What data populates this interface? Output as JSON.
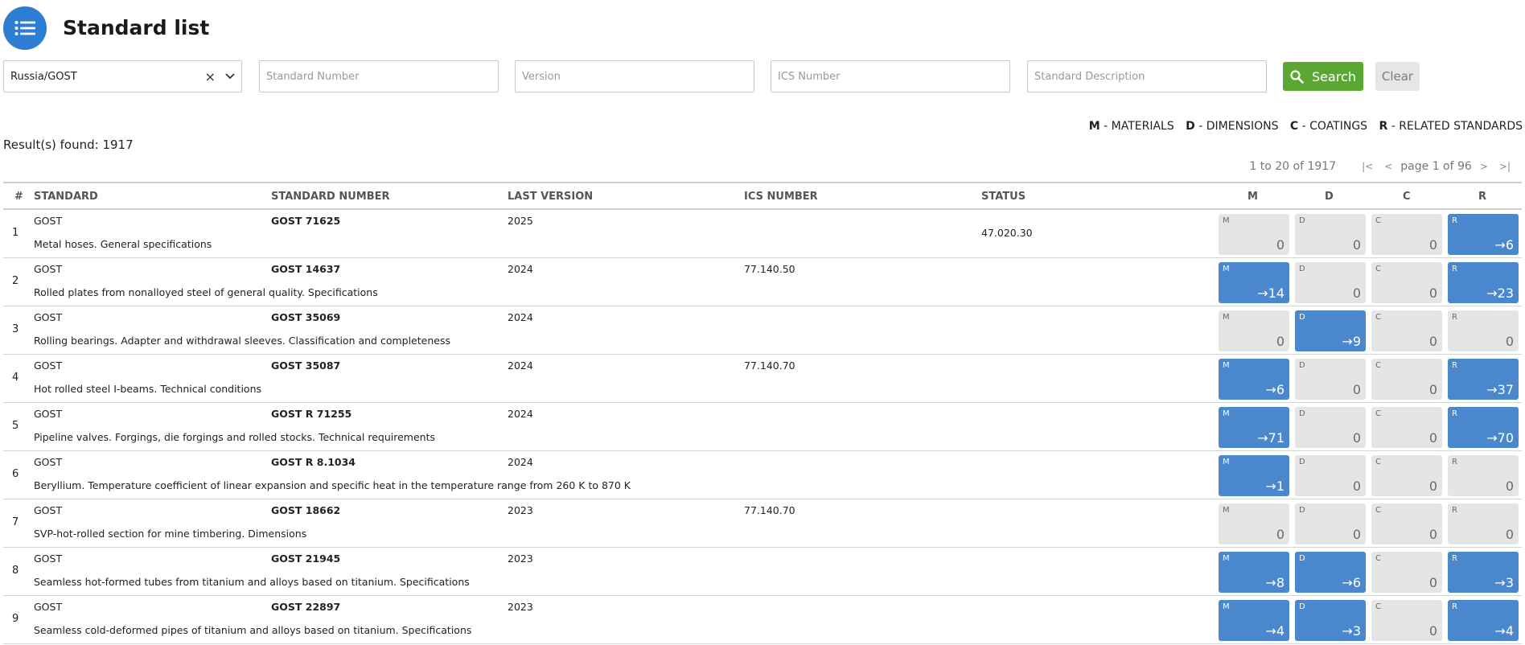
{
  "header": {
    "title": "Standard list",
    "menu_icon": "list-icon"
  },
  "filters": {
    "country_value": "Russia/GOST",
    "standard_number_placeholder": "Standard Number",
    "version_placeholder": "Version",
    "ics_placeholder": "ICS Number",
    "description_placeholder": "Standard Description",
    "search_label": "Search",
    "clear_label": "Clear"
  },
  "legend": {
    "m_key": "M",
    "m_text": "- MATERIALS",
    "d_key": "D",
    "d_text": "- DIMENSIONS",
    "c_key": "C",
    "c_text": "- COATINGS",
    "r_key": "R",
    "r_text": "- RELATED STANDARDS"
  },
  "results_text": "Result(s) found: 1917",
  "pager": {
    "range_text": "1 to 20 of 1917",
    "page_text": "page 1 of 96"
  },
  "columns": {
    "num": "#",
    "standard": "STANDARD",
    "standard_number": "STANDARD NUMBER",
    "last_version": "LAST VERSION",
    "ics_number": "ICS NUMBER",
    "status": "STATUS",
    "m": "M",
    "d": "D",
    "c": "C",
    "r": "R"
  },
  "rows": [
    {
      "num": "1",
      "standard": "GOST",
      "description": "Metal hoses. General specifications",
      "number": "GOST 71625",
      "version": "2025",
      "ics": "",
      "status": "47.020.30",
      "m": "0",
      "d": "0",
      "c": "0",
      "r": "→6"
    },
    {
      "num": "2",
      "standard": "GOST",
      "description": "Rolled plates from nonalloyed steel of general quality. Specifications",
      "number": "GOST 14637",
      "version": "2024",
      "ics": "77.140.50",
      "status": "",
      "m": "→14",
      "d": "0",
      "c": "0",
      "r": "→23"
    },
    {
      "num": "3",
      "standard": "GOST",
      "description": "Rolling bearings. Adapter and withdrawal sleeves. Classification and completeness",
      "number": "GOST 35069",
      "version": "2024",
      "ics": "",
      "status": "",
      "m": "0",
      "d": "→9",
      "c": "0",
      "r": "0"
    },
    {
      "num": "4",
      "standard": "GOST",
      "description": "Hot rolled steel I-beams. Technical conditions",
      "number": "GOST 35087",
      "version": "2024",
      "ics": "77.140.70",
      "status": "",
      "m": "→6",
      "d": "0",
      "c": "0",
      "r": "→37"
    },
    {
      "num": "5",
      "standard": "GOST",
      "description": "Pipeline valves. Forgings, die forgings and rolled stocks. Technical requirements",
      "number": "GOST R 71255",
      "version": "2024",
      "ics": "",
      "status": "",
      "m": "→71",
      "d": "0",
      "c": "0",
      "r": "→70"
    },
    {
      "num": "6",
      "standard": "GOST",
      "description": "Beryllium. Temperature coefficient of linear expansion and specific heat in the temperature range from 260 K to 870 K",
      "number": "GOST R 8.1034",
      "version": "2024",
      "ics": "",
      "status": "",
      "m": "→1",
      "d": "0",
      "c": "0",
      "r": "0"
    },
    {
      "num": "7",
      "standard": "GOST",
      "description": "SVP-hot-rolled section for mine timbering. Dimensions",
      "number": "GOST 18662",
      "version": "2023",
      "ics": "77.140.70",
      "status": "",
      "m": "0",
      "d": "0",
      "c": "0",
      "r": "0"
    },
    {
      "num": "8",
      "standard": "GOST",
      "description": "Seamless hot-formed tubes from titanium and alloys based on titanium. Specifications",
      "number": "GOST 21945",
      "version": "2023",
      "ics": "",
      "status": "",
      "m": "→8",
      "d": "→6",
      "c": "0",
      "r": "→3"
    },
    {
      "num": "9",
      "standard": "GOST",
      "description": "Seamless cold-deformed pipes of titanium and alloys based on titanium. Specifications",
      "number": "GOST 22897",
      "version": "2023",
      "ics": "",
      "status": "",
      "m": "→4",
      "d": "→3",
      "c": "0",
      "r": "→4"
    }
  ]
}
